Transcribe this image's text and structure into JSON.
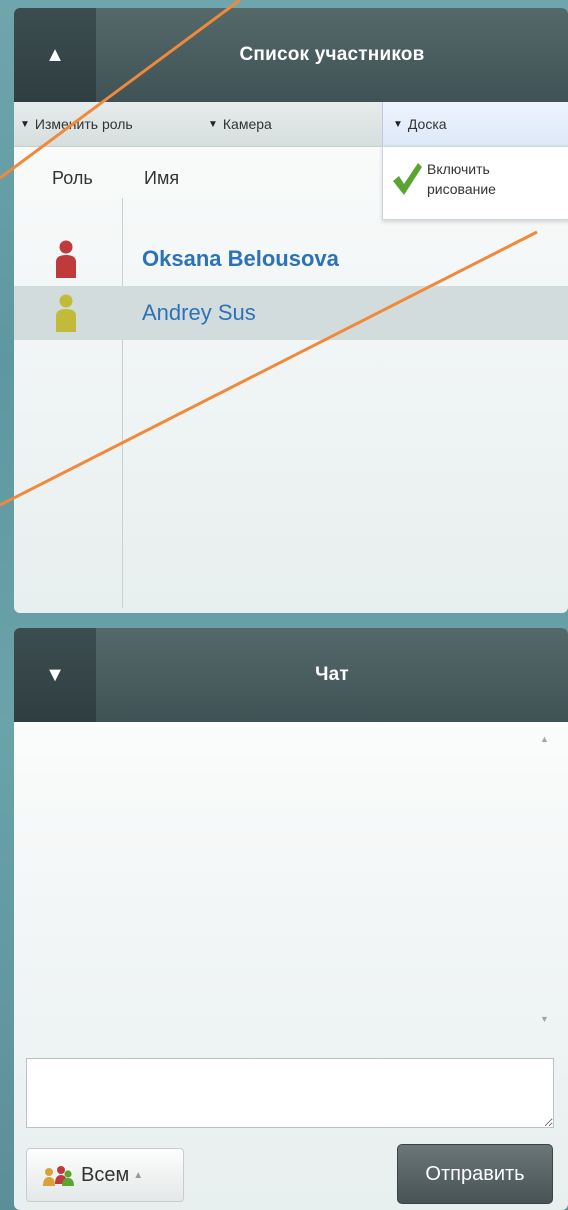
{
  "participants": {
    "title": "Список участников",
    "toggle_icon": "▲",
    "toolbar": {
      "change_role": "Изменить роль",
      "camera": "Камера",
      "board": "Доска"
    },
    "dropdown": {
      "line1": "Включить",
      "line2": "рисование"
    },
    "columns": {
      "role": "Роль",
      "name": "Имя"
    },
    "rows": [
      {
        "name": "Oksana Belousova",
        "role_color": "#c0393b",
        "bold": true,
        "selected": false
      },
      {
        "name": "Andrey Sus",
        "role_color": "#c2bb3a",
        "bold": false,
        "selected": true
      }
    ]
  },
  "chat": {
    "title": "Чат",
    "toggle_icon": "▼",
    "input_value": "",
    "audience_label": "Всем",
    "send_label": "Отправить"
  },
  "colors": {
    "annotation_line": "#f0893a",
    "name_link": "#2d72b9",
    "check": "#5aa532"
  }
}
